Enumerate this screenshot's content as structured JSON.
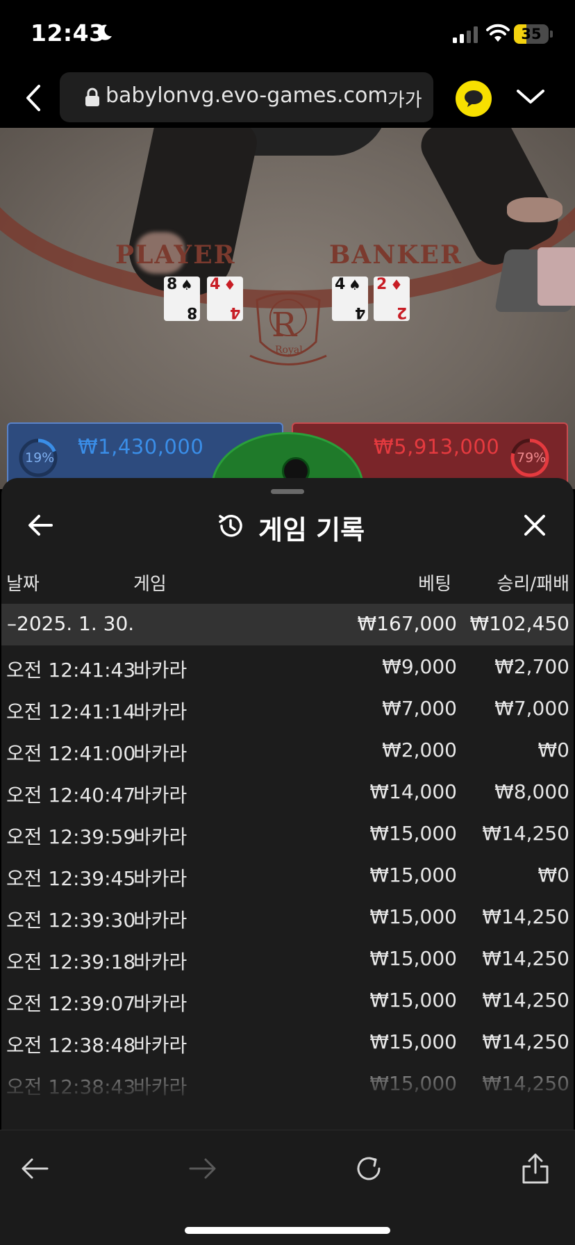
{
  "status_bar": {
    "time": "12:43",
    "battery": "35",
    "battery_fraction": 0.35,
    "accent": "#f4d20f"
  },
  "browser": {
    "url": "babylonvg.evo-games.com",
    "text_size_label": "가가",
    "icons": [
      "back-chevron-icon",
      "lock-icon",
      "kakaotalk-icon",
      "chevron-down-icon"
    ]
  },
  "game": {
    "player_label": "PLAYER",
    "banker_label": "BANKER",
    "logo_letter": "R",
    "logo_word": "Royal",
    "player_cards": [
      {
        "rank": "8",
        "suit": "♠",
        "color": "black"
      },
      {
        "rank": "4",
        "suit": "♦",
        "color": "red"
      }
    ],
    "banker_cards": [
      {
        "rank": "4",
        "suit": "♠",
        "color": "black"
      },
      {
        "rank": "2",
        "suit": "♦",
        "color": "red"
      }
    ],
    "player_panel": {
      "percent": "19%",
      "amount": "₩1,430,000",
      "color": "#2d4b7e"
    },
    "banker_panel": {
      "percent": "79%",
      "amount": "₩5,913,000",
      "color": "#7a2529"
    }
  },
  "history_sheet": {
    "title": "게임 기록",
    "columns": {
      "date": "날짜",
      "game": "게임",
      "bet": "베팅",
      "win_loss": "승리/패배"
    },
    "summary": {
      "date": "–2025. 1. 30.",
      "bet": "₩167,000",
      "win_loss": "₩102,450"
    },
    "rows": [
      {
        "time": "오전 12:41:43",
        "game": "바카라",
        "bet": "₩9,000",
        "win_loss": "₩2,700"
      },
      {
        "time": "오전 12:41:14",
        "game": "바카라",
        "bet": "₩7,000",
        "win_loss": "₩7,000"
      },
      {
        "time": "오전 12:41:00",
        "game": "바카라",
        "bet": "₩2,000",
        "win_loss": "₩0"
      },
      {
        "time": "오전 12:40:47",
        "game": "바카라",
        "bet": "₩14,000",
        "win_loss": "₩8,000"
      },
      {
        "time": "오전 12:39:59",
        "game": "바카라",
        "bet": "₩15,000",
        "win_loss": "₩14,250"
      },
      {
        "time": "오전 12:39:45",
        "game": "바카라",
        "bet": "₩15,000",
        "win_loss": "₩0"
      },
      {
        "time": "오전 12:39:30",
        "game": "바카라",
        "bet": "₩15,000",
        "win_loss": "₩14,250"
      },
      {
        "time": "오전 12:39:18",
        "game": "바카라",
        "bet": "₩15,000",
        "win_loss": "₩14,250"
      },
      {
        "time": "오전 12:39:07",
        "game": "바카라",
        "bet": "₩15,000",
        "win_loss": "₩14,250"
      },
      {
        "time": "오전 12:38:48",
        "game": "바카라",
        "bet": "₩15,000",
        "win_loss": "₩14,250"
      },
      {
        "time": "오전 12:38:43",
        "game": "바카라",
        "bet": "₩15,000",
        "win_loss": "₩14,250"
      }
    ]
  },
  "toolbar": {
    "icons": [
      "back-arrow-icon",
      "forward-arrow-icon",
      "reload-icon",
      "share-icon"
    ]
  }
}
